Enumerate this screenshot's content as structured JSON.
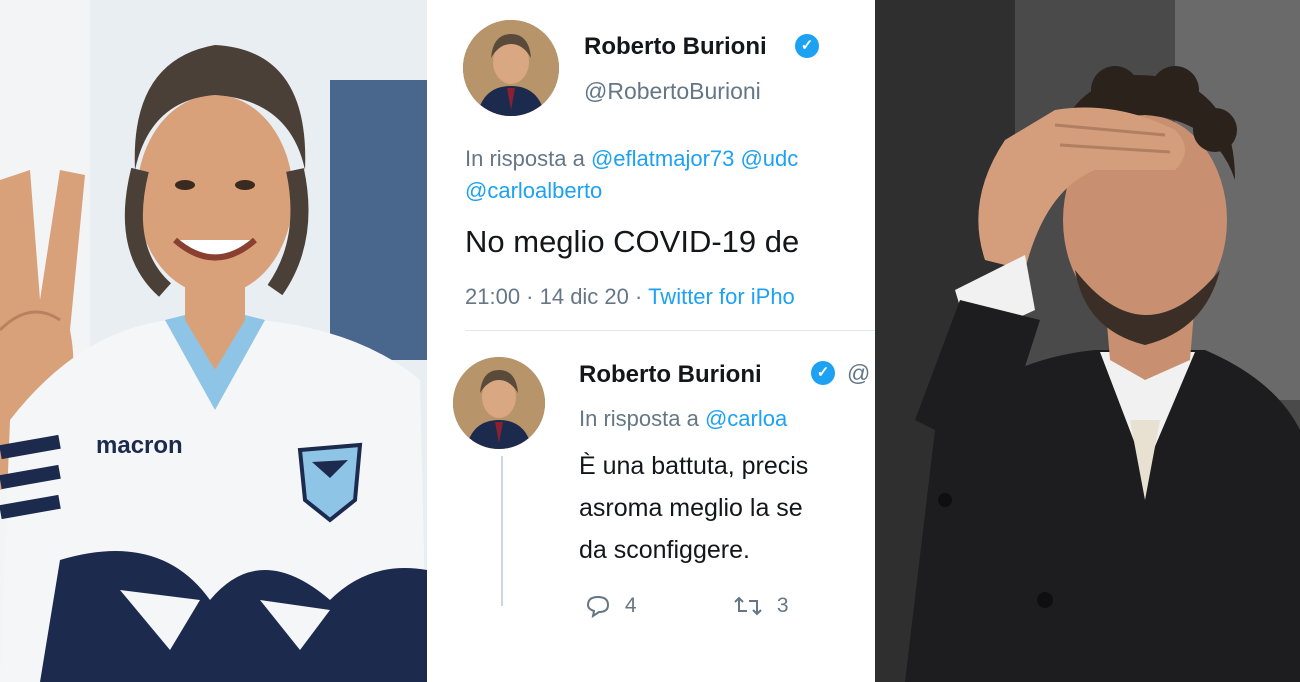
{
  "tweet1": {
    "name": "Roberto Burioni",
    "handle": "@RobertoBurioni",
    "reply_prefix": "In risposta a",
    "reply_mentions_1": "@eflatmajor73 @udc",
    "reply_mentions_2": "@carloalberto",
    "text": "No meglio COVID-19 de",
    "time": "21:00 · 14 dic 20",
    "source": "Twitter for iPho"
  },
  "tweet2": {
    "name": "Roberto Burioni",
    "handle_fragment": "@",
    "reply_prefix": "In risposta a",
    "reply_mentions": "@carloa",
    "text_line1": "È una battuta, precis",
    "text_line2": "asroma meglio la se",
    "text_line3": "da sconfiggere.",
    "replies_count": "4",
    "retweets_count": "3"
  },
  "left_photo": {
    "shirt_brand": "macron",
    "colors": {
      "shirt": "#f4f6f8",
      "collar": "#8ec4e6",
      "stripe": "#1c2a4e"
    }
  },
  "colors": {
    "link": "#1da1f2",
    "secondary": "#657786",
    "text": "#14171a"
  }
}
